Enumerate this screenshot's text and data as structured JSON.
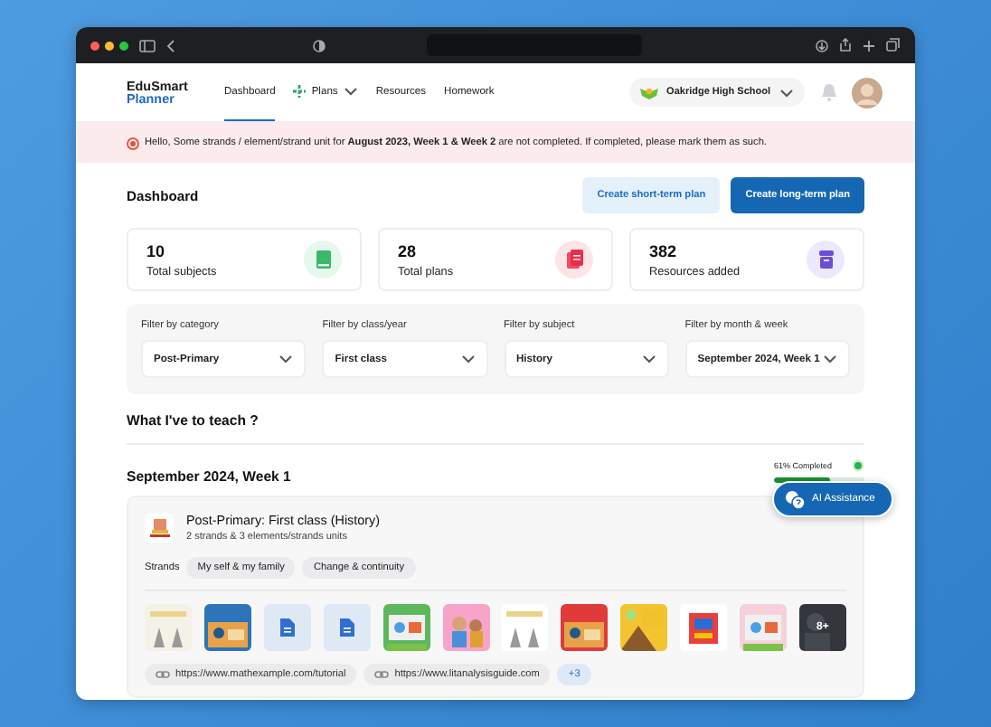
{
  "app": {
    "logo_line1": "EduSmart",
    "logo_line2": "Planner"
  },
  "nav": [
    {
      "label": "Dashboard",
      "selected": true,
      "kind": "link"
    },
    {
      "label": "Plans",
      "selected": false,
      "kind": "menu"
    },
    {
      "label": "Resources",
      "selected": false,
      "kind": "link"
    },
    {
      "label": "Homework",
      "selected": false,
      "kind": "link"
    }
  ],
  "school": {
    "name": "Oakridge High School"
  },
  "alert": {
    "text": "Hello, Some strands / element/strand unit for **August 2023, Week 1 & Week 2** are not completed. If completed, please mark them as such."
  },
  "dashboard": {
    "title": "Dashboard",
    "buttons": [
      {
        "label": "Create short-term plan",
        "kind": "secondary"
      },
      {
        "label": "Create long-term plan",
        "kind": "primary"
      }
    ]
  },
  "stats": [
    {
      "value": "10",
      "label": "Total subjects",
      "kind": "subjects"
    },
    {
      "value": "28",
      "label": "Total plans",
      "kind": "plans"
    },
    {
      "value": "382",
      "label": "Resources added",
      "kind": "resources"
    }
  ],
  "filters": [
    {
      "label": "Filter by category",
      "value": "Post-Primary"
    },
    {
      "label": "Filter by class/year",
      "value": "First class"
    },
    {
      "label": "Filter by subject",
      "value": "History"
    },
    {
      "label": "Filter by month & week",
      "value": "September 2024, Week 1"
    }
  ],
  "teach": {
    "title": "What I've to teach ?",
    "week": "September 2024, Week 1",
    "progress": {
      "label": "61% Completed",
      "level": 0.61
    }
  },
  "plan": {
    "title": "Post-Primary: First class (History)",
    "subtitle": "2 strands & 3 elements/strands units",
    "strands_label": "Strands",
    "strands": [
      "My self & my family",
      "Change & continuity"
    ],
    "thumbnails": [
      {
        "kind": "picture"
      },
      {
        "kind": "picture"
      },
      {
        "kind": "doc"
      },
      {
        "kind": "doc"
      },
      {
        "kind": "picture"
      },
      {
        "kind": "picture"
      },
      {
        "kind": "picture"
      },
      {
        "kind": "picture"
      },
      {
        "kind": "picture"
      },
      {
        "kind": "picture"
      },
      {
        "kind": "picture"
      },
      {
        "kind": "more",
        "label": "8+"
      }
    ],
    "links": [
      "https://www.mathexample.com/tutorial",
      "https://www.litanalysisguide.com"
    ],
    "more_links": "+3"
  },
  "assistant": {
    "label": "AI Assistance"
  }
}
